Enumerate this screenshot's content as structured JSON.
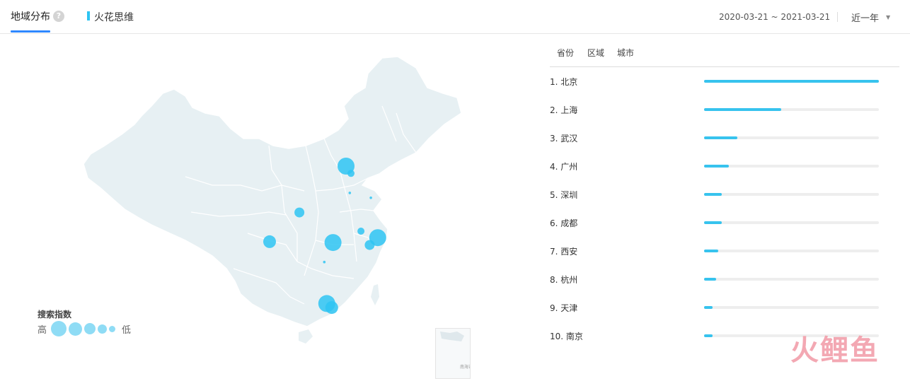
{
  "header": {
    "active_tab": "地域分布",
    "help_icon": "?",
    "brand": "火花思维",
    "date_range": "2020-03-21 ~ 2021-03-21",
    "period": "近一年"
  },
  "legend": {
    "title": "搜索指数",
    "high": "高",
    "low": "低"
  },
  "map": {
    "inset_label": "南海诸岛",
    "bubbles": [
      {
        "name": "北京",
        "lon": 116.4,
        "lat": 40.0,
        "level": 5
      },
      {
        "name": "天津",
        "lon": 117.2,
        "lat": 39.1,
        "level": 1
      },
      {
        "name": "上海",
        "lon": 121.5,
        "lat": 31.2,
        "level": 5
      },
      {
        "name": "杭州",
        "lon": 120.2,
        "lat": 30.3,
        "level": 2
      },
      {
        "name": "南京",
        "lon": 118.8,
        "lat": 32.0,
        "level": 1
      },
      {
        "name": "武汉",
        "lon": 114.3,
        "lat": 30.6,
        "level": 4
      },
      {
        "name": "西安",
        "lon": 108.9,
        "lat": 34.3,
        "level": 2
      },
      {
        "name": "成都",
        "lon": 104.1,
        "lat": 30.7,
        "level": 3
      },
      {
        "name": "广州",
        "lon": 113.3,
        "lat": 23.1,
        "level": 4
      },
      {
        "name": "深圳",
        "lon": 114.1,
        "lat": 22.6,
        "level": 3
      },
      {
        "name": "青岛",
        "lon": 120.4,
        "lat": 36.1,
        "level": 0
      },
      {
        "name": "济南",
        "lon": 117.0,
        "lat": 36.7,
        "level": 0
      },
      {
        "name": "长沙",
        "lon": 112.9,
        "lat": 28.2,
        "level": 0
      }
    ]
  },
  "panel": {
    "tabs": [
      "省份",
      "区域",
      "城市"
    ],
    "rankings": [
      {
        "label": "1.  北京",
        "value": 1.0
      },
      {
        "label": "2.  上海",
        "value": 0.44
      },
      {
        "label": "3.  武汉",
        "value": 0.19
      },
      {
        "label": "4.  广州",
        "value": 0.14
      },
      {
        "label": "5.  深圳",
        "value": 0.1
      },
      {
        "label": "6.  成都",
        "value": 0.1
      },
      {
        "label": "7.  西安",
        "value": 0.08
      },
      {
        "label": "8.  杭州",
        "value": 0.07
      },
      {
        "label": "9.  天津",
        "value": 0.05
      },
      {
        "label": "10. 南京",
        "value": 0.05
      }
    ]
  },
  "watermark": "火鲤鱼",
  "colors": {
    "accent": "#2f88ff",
    "bar": "#37c3ee",
    "bubble": "#2ec4f2",
    "map_fill": "#e7f0f3"
  }
}
